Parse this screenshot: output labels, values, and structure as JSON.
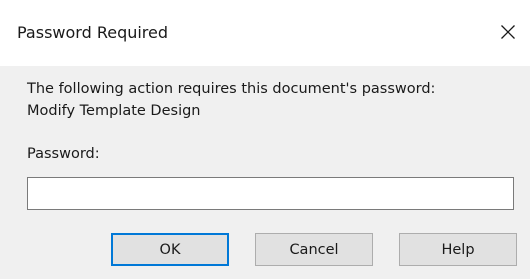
{
  "dialog": {
    "title": "Password Required",
    "message_line1": "The following action requires this document's password:",
    "message_line2": "Modify Template Design",
    "password_label": "Password:",
    "password_value": "",
    "buttons": {
      "ok": "OK",
      "cancel": "Cancel",
      "help": "Help"
    },
    "close_icon": "close-icon"
  },
  "colors": {
    "titlebar_bg": "#ffffff",
    "dialog_bg": "#f0f0f0",
    "default_button_border": "#0078d7",
    "button_bg": "#e1e1e1"
  }
}
